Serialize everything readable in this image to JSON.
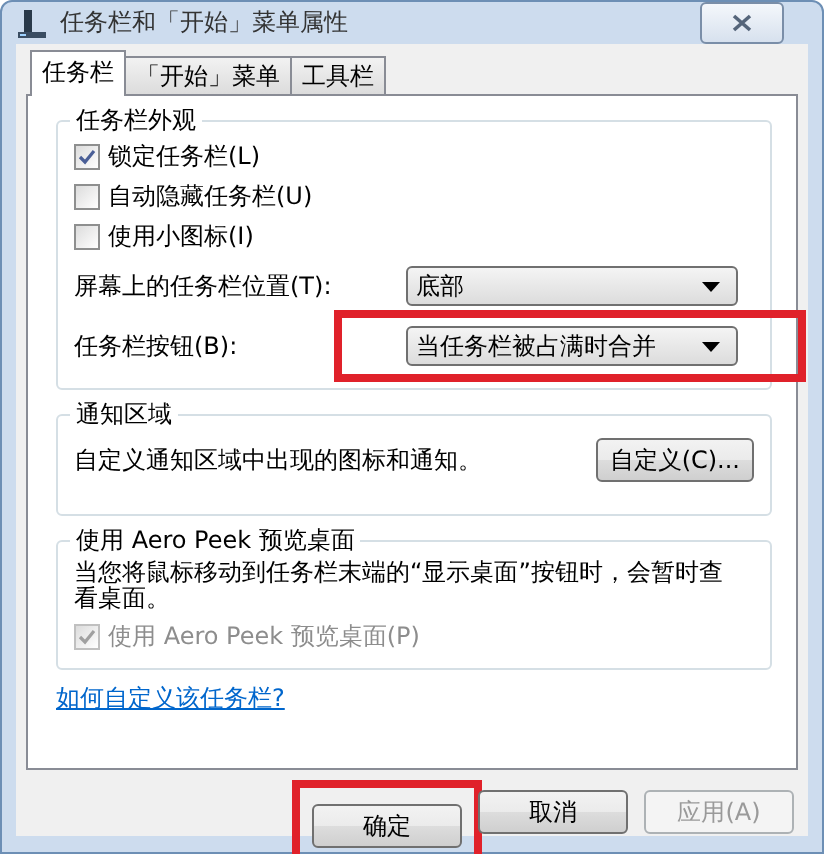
{
  "window": {
    "title": "任务栏和「开始」菜单属性"
  },
  "tabs": [
    {
      "label": "任务栏",
      "selected": true
    },
    {
      "label": "「开始」菜单",
      "selected": false
    },
    {
      "label": "工具栏",
      "selected": false
    }
  ],
  "groups": [
    {
      "title": "任务栏外观",
      "items": [
        {
          "kind": "checkbox",
          "label": "锁定任务栏(L)",
          "checked": true,
          "disabled": false
        },
        {
          "kind": "checkbox",
          "label": "自动隐藏任务栏(U)",
          "checked": false,
          "disabled": false
        },
        {
          "kind": "checkbox",
          "label": "使用小图标(I)",
          "checked": false,
          "disabled": false
        },
        {
          "kind": "dropdown",
          "label": "屏幕上的任务栏位置(T):",
          "value": "底部",
          "highlighted": false
        },
        {
          "kind": "dropdown",
          "label": "任务栏按钮(B):",
          "value": "当任务栏被占满时合并",
          "highlighted": true
        }
      ]
    },
    {
      "title": "通知区域",
      "items": [
        {
          "kind": "text_button",
          "text": "自定义通知区域中出现的图标和通知。",
          "button": "自定义(C)..."
        }
      ]
    },
    {
      "title": "使用 Aero Peek 预览桌面",
      "items": [
        {
          "kind": "text",
          "text": "当您将鼠标移动到任务栏末端的“显示桌面”按钮时，会暂时查看桌面。"
        },
        {
          "kind": "checkbox",
          "label": "使用 Aero Peek 预览桌面(P)",
          "checked": true,
          "disabled": true
        }
      ]
    }
  ],
  "link": "如何自定义该任务栏?",
  "buttons": [
    {
      "label": "确定",
      "disabled": false,
      "highlighted": true
    },
    {
      "label": "取消",
      "disabled": false,
      "highlighted": false
    },
    {
      "label": "应用(A)",
      "disabled": true,
      "highlighted": false
    }
  ]
}
